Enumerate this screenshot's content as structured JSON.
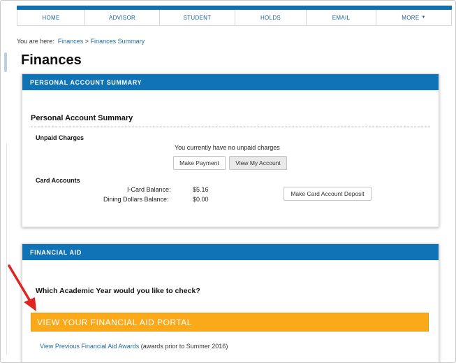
{
  "nav": {
    "items": [
      {
        "label": "HOME"
      },
      {
        "label": "ADVISOR"
      },
      {
        "label": "STUDENT"
      },
      {
        "label": "HOLDS"
      },
      {
        "label": "EMAIL"
      },
      {
        "label": "MORE"
      }
    ]
  },
  "breadcrumb": {
    "prefix": "You are here:",
    "link1": "Finances",
    "separator": ">",
    "link2": "Finances Summary"
  },
  "page": {
    "title": "Finances"
  },
  "personal_account": {
    "header": "PERSONAL ACCOUNT SUMMARY",
    "title": "Personal Account Summary",
    "unpaid_label": "Unpaid Charges",
    "unpaid_message": "You currently have no unpaid charges",
    "make_payment": "Make Payment",
    "view_account": "View My Account",
    "card_accounts_label": "Card Accounts",
    "icard_label": "I-Card Balance:",
    "icard_value": "$5.16",
    "dining_label": "Dining Dollars Balance:",
    "dining_value": "$0.00",
    "deposit_button": "Make Card Account Deposit"
  },
  "financial_aid": {
    "header": "FINANCIAL AID",
    "question": "Which Academic Year would you like to check?",
    "portal_button": "VIEW YOUR FINANCIAL AID PORTAL",
    "prev_link": "View Previous Financial Aid Awards",
    "prev_note": "(awards prior to Summer 2016)"
  },
  "colors": {
    "brand_blue": "#0f73b6",
    "portal_orange": "#fba919",
    "annotation_red": "#e0241f"
  }
}
